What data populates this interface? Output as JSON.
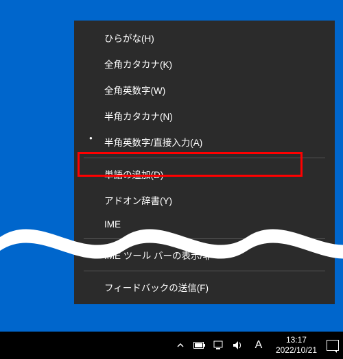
{
  "menu": {
    "items": [
      {
        "label": "ひらがな(H)",
        "selected": false
      },
      {
        "label": "全角カタカナ(K)",
        "selected": false
      },
      {
        "label": "全角英数字(W)",
        "selected": false
      },
      {
        "label": "半角カタカナ(N)",
        "selected": false
      },
      {
        "label": "半角英数字/直接入力(A)",
        "selected": true
      }
    ],
    "sep1": true,
    "add_word": "単語の追加(D)",
    "addon_dict": "アドオン辞書(Y)",
    "ime_cut": "IME",
    "sep2": true,
    "ime_toolbar": "IME ツール バーの表示/非",
    "sep3": true,
    "feedback": "フィードバックの送信(F)"
  },
  "taskbar": {
    "ime_indicator": "A",
    "time": "13:17",
    "date": "2022/10/21"
  }
}
